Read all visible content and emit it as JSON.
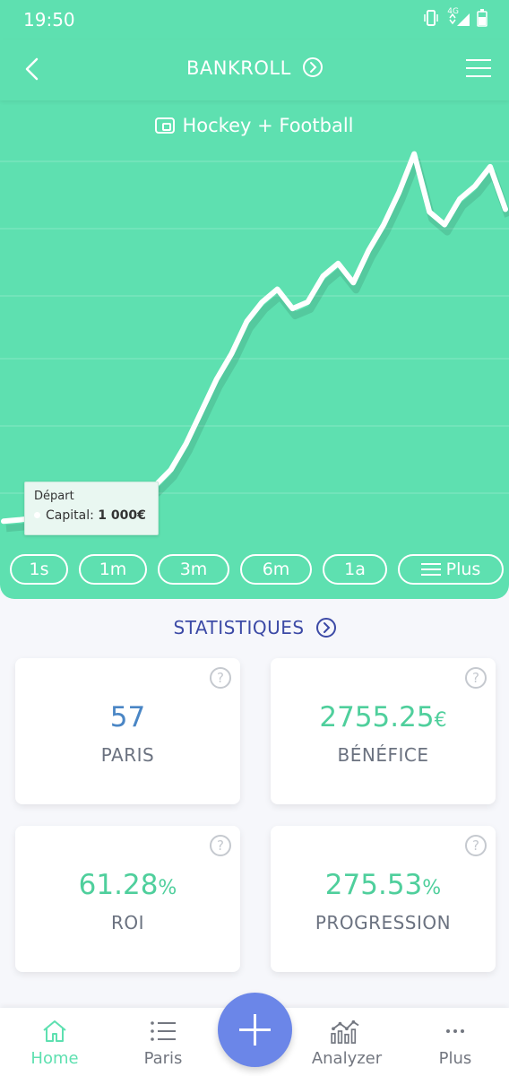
{
  "status_bar": {
    "time": "19:50",
    "network": "4G"
  },
  "header": {
    "title": "BANKROLL",
    "back_icon": "chevron-left-icon",
    "menu_icon": "hamburger-icon"
  },
  "wallet": {
    "label": "Hockey + Football",
    "icon": "wallet-icon"
  },
  "chart_data": {
    "type": "area",
    "title": "",
    "xlabel": "",
    "ylabel": "",
    "grid": true,
    "series": [
      {
        "values": [
          1000,
          1010,
          1025,
          1020,
          1040,
          1050,
          1080,
          1100,
          1150,
          1200,
          1280,
          1400,
          1600,
          1850,
          2100,
          2300,
          2550,
          2700,
          2800,
          2650,
          2700,
          2900,
          3000,
          2850,
          3100,
          3300,
          3550,
          3850,
          3400,
          3300,
          3500,
          3600,
          3750,
          3420
        ]
      }
    ]
  },
  "tooltip": {
    "title": "Départ",
    "label": "Capital: ",
    "value": "1 000€"
  },
  "periods": [
    "1s",
    "1m",
    "3m",
    "6m",
    "1a"
  ],
  "more_filter": {
    "label": "Plus",
    "icon": "sliders-icon"
  },
  "stats": {
    "title": "STATISTIQUES",
    "help_symbol": "?",
    "cards": [
      {
        "value": "57",
        "unit": "",
        "label": "PARIS",
        "color": "#4a86c5"
      },
      {
        "value": "2755.25",
        "unit": "€",
        "label": "BÉNÉFICE",
        "color": "#4fcf9c"
      },
      {
        "value": "61.28",
        "unit": "%",
        "label": "ROI",
        "color": "#4fcf9c"
      },
      {
        "value": "275.53",
        "unit": "%",
        "label": "PROGRESSION",
        "color": "#4fcf9c"
      }
    ]
  },
  "nav": {
    "items": [
      {
        "label": "Home",
        "icon": "home-icon",
        "active": true
      },
      {
        "label": "Paris",
        "icon": "list-icon",
        "active": false
      },
      {
        "label": "Analyzer",
        "icon": "analytics-icon",
        "active": false
      },
      {
        "label": "Plus",
        "icon": "more-dots-icon",
        "active": false
      }
    ],
    "fab_icon": "plus-icon"
  },
  "colors": {
    "primary": "#5ee0b0",
    "accent": "#6b86e8",
    "title": "#3c4aa6"
  }
}
